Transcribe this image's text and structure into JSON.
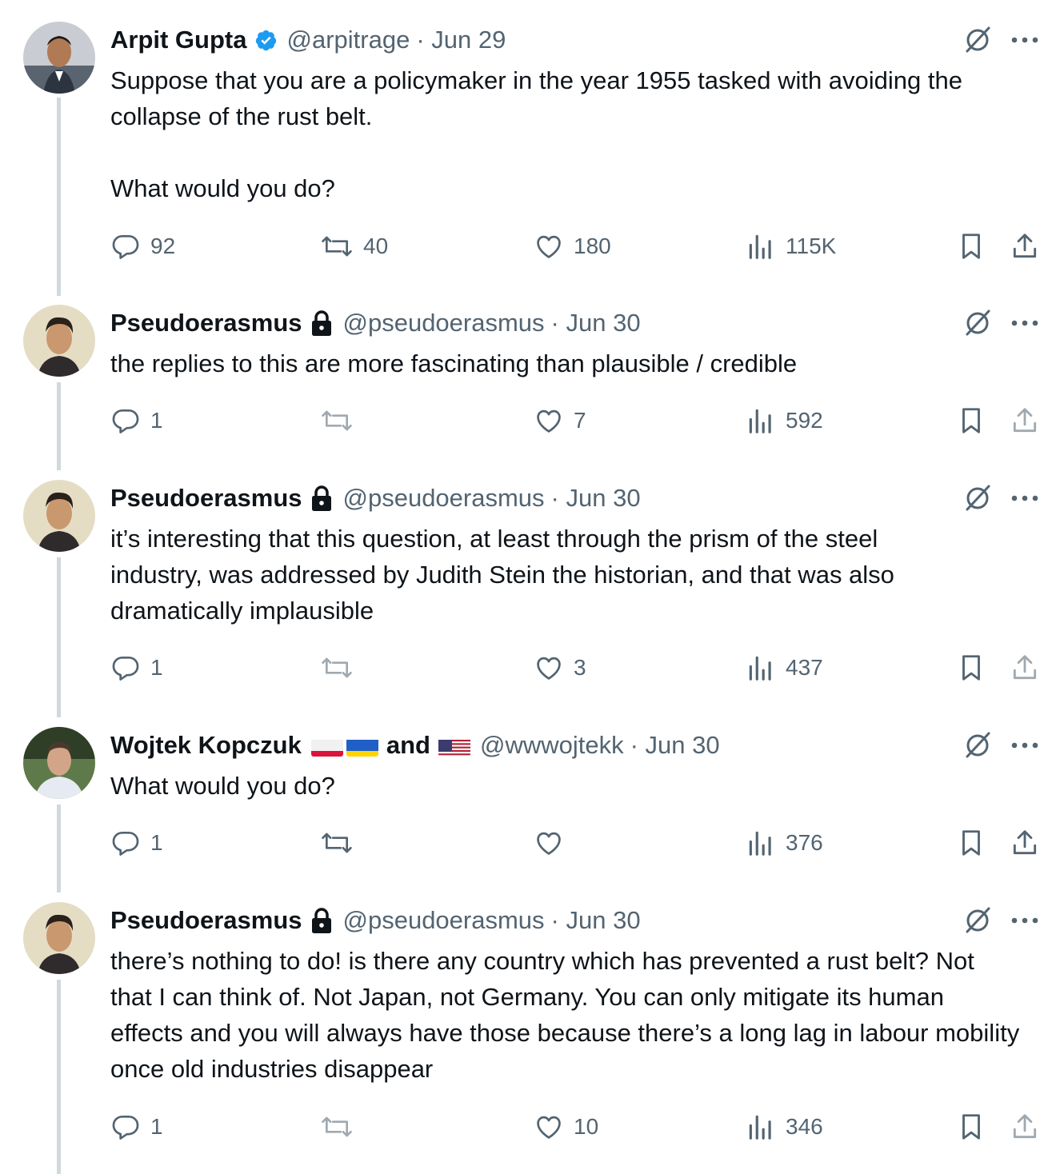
{
  "colors": {
    "text": "#0f1419",
    "secondary": "#536471",
    "thread_line": "#cfd9de",
    "verified": "#1d9bf0"
  },
  "tweets": [
    {
      "name": "Arpit Gupta",
      "verified": true,
      "handle": "@arpitrage",
      "date": "· Jun 29",
      "paragraphs": [
        "Suppose that you are a policymaker in the year 1955 tasked with avoiding the collapse of the rust belt.",
        "What would you do?"
      ],
      "replies": "92",
      "retweets": "40",
      "likes": "180",
      "views": "115K"
    },
    {
      "name": "Pseudoerasmus",
      "protected": true,
      "handle": "@pseudoerasmus",
      "date": "· Jun 30",
      "paragraphs": [
        "the replies to this are more fascinating than plausible / credible"
      ],
      "replies": "1",
      "retweets": "",
      "likes": "7",
      "views": "592"
    },
    {
      "name": "Pseudoerasmus",
      "protected": true,
      "handle": "@pseudoerasmus",
      "date": "· Jun 30",
      "paragraphs": [
        "it’s interesting that this question, at least through the prism of the steel industry, was addressed by Judith Stein the historian, and that was also dramatically implausible"
      ],
      "replies": "1",
      "retweets": "",
      "likes": "3",
      "views": "437"
    },
    {
      "name": "Wojtek Kopczuk",
      "name_suffix": "and",
      "flags": [
        "poland-flag",
        "ukraine-flag",
        "usa-flag"
      ],
      "handle": "@wwwojtekk",
      "date": "· Jun 30",
      "paragraphs": [
        "What would you do?"
      ],
      "replies": "1",
      "retweets": "",
      "likes": "",
      "views": "376"
    },
    {
      "name": "Pseudoerasmus",
      "protected": true,
      "handle": "@pseudoerasmus",
      "date": "· Jun 30",
      "paragraphs": [
        "there’s nothing to do! is there any country which has prevented a rust belt? Not that I can think of. Not Japan, not Germany. You can only mitigate its human effects and you will always have those because there’s a long lag in labour mobility once old industries disappear"
      ],
      "replies": "1",
      "retweets": "",
      "likes": "10",
      "views": "346"
    }
  ]
}
